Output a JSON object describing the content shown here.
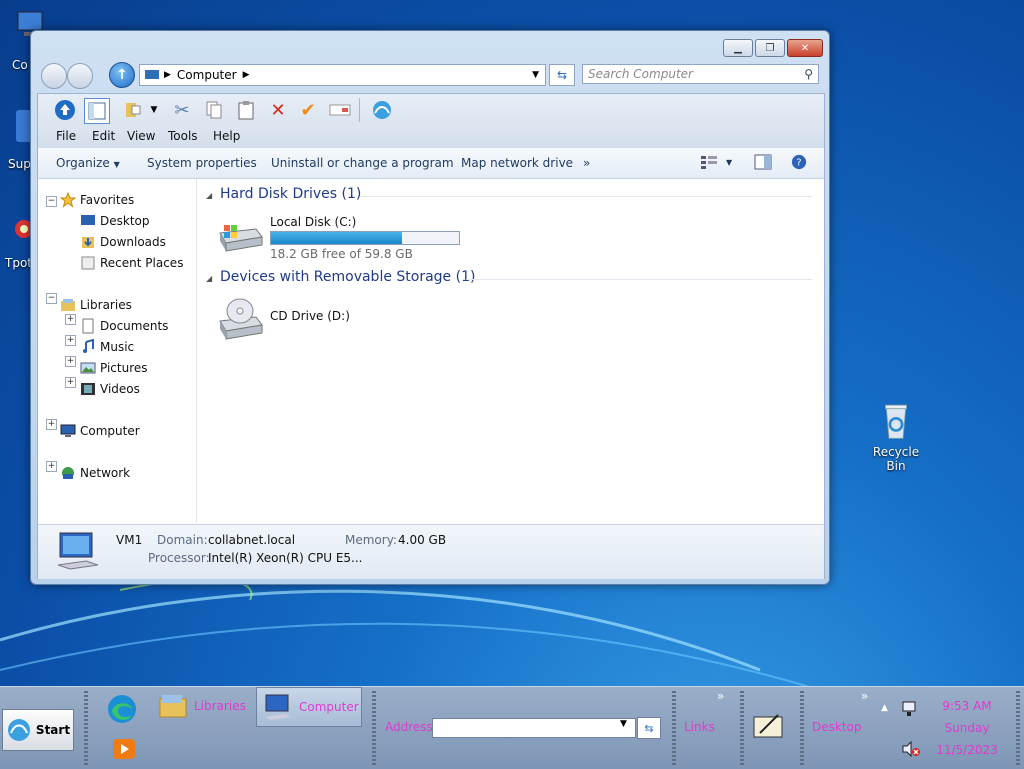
{
  "desktop": {
    "icons_left": [
      {
        "label": "Co",
        "name": "computer"
      },
      {
        "label": "Sup",
        "name": "support"
      },
      {
        "label": "Tpot",
        "name": "tpot"
      }
    ],
    "recycle_bin": "Recycle Bin"
  },
  "window": {
    "address": {
      "location": "Computer"
    },
    "search_placeholder": "Search Computer",
    "menu": [
      "File",
      "Edit",
      "View",
      "Tools",
      "Help"
    ],
    "commands": {
      "organize": "Organize",
      "system_properties": "System properties",
      "uninstall": "Uninstall or change a program",
      "map_drive": "Map network drive",
      "more": "»"
    },
    "nav": {
      "favorites": "Favorites",
      "desktop": "Desktop",
      "downloads": "Downloads",
      "recent": "Recent Places",
      "libraries": "Libraries",
      "documents": "Documents",
      "music": "Music",
      "pictures": "Pictures",
      "videos": "Videos",
      "computer": "Computer",
      "network": "Network"
    },
    "groups": {
      "hdd": "Hard Disk Drives (1)",
      "removable": "Devices with Removable Storage (1)"
    },
    "drives": {
      "local_name": "Local Disk (C:)",
      "local_free": "18.2 GB free of 59.8 GB",
      "local_used_fraction": 0.696,
      "cd_name": "CD Drive (D:)"
    },
    "details": {
      "name": "VM1",
      "domain_label": "Domain:",
      "domain": "collabnet.local",
      "memory_label": "Memory:",
      "memory": "4.00 GB",
      "processor_label": "Processor:",
      "processor": "Intel(R) Xeon(R) CPU E5..."
    }
  },
  "taskbar": {
    "start": "Start",
    "tasks": {
      "libraries": "Libraries",
      "computer": "Computer"
    },
    "address_label": "Address",
    "links_label": "Links",
    "desktop_label": "Desktop",
    "chevron": "»",
    "clock": {
      "time": "9:53 AM",
      "day": "Sunday",
      "date": "11/5/2023"
    }
  },
  "colors": {
    "accent": "#1b86c8",
    "taskbar_text": "#e03ad0"
  }
}
